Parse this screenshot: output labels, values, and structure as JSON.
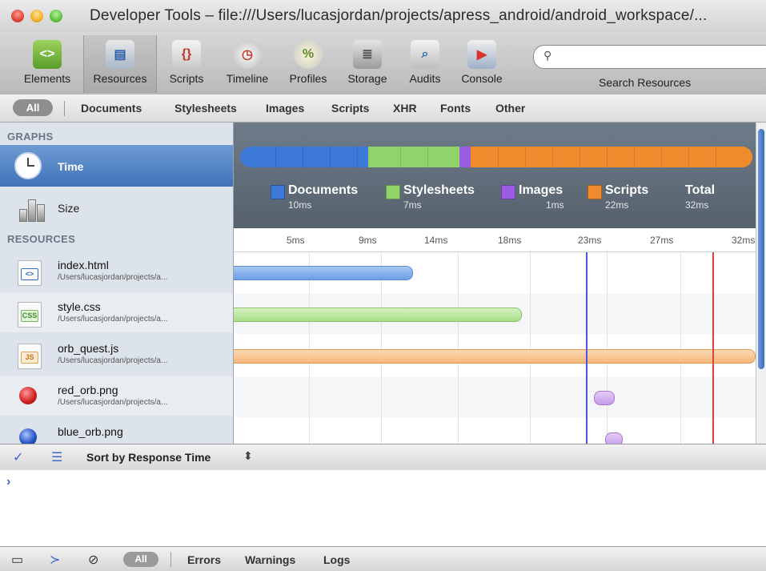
{
  "window": {
    "title": "Developer Tools – file:///Users/lucasjordan/projects/apress_android/android_workspace/..."
  },
  "toolbar": {
    "buttons": [
      {
        "label": "Elements",
        "icon": "elements-icon"
      },
      {
        "label": "Resources",
        "icon": "resources-icon"
      },
      {
        "label": "Scripts",
        "icon": "scripts-icon"
      },
      {
        "label": "Timeline",
        "icon": "timeline-icon"
      },
      {
        "label": "Profiles",
        "icon": "profiles-icon"
      },
      {
        "label": "Storage",
        "icon": "storage-icon"
      },
      {
        "label": "Audits",
        "icon": "audits-icon"
      },
      {
        "label": "Console",
        "icon": "console-icon"
      }
    ],
    "selected": "Resources",
    "search_label": "Search Resources",
    "search_placeholder": ""
  },
  "filter": {
    "all": "All",
    "items": [
      "Documents",
      "Stylesheets",
      "Images",
      "Scripts",
      "XHR",
      "Fonts",
      "Other"
    ]
  },
  "sidebar": {
    "graphs_header": "GRAPHS",
    "time_label": "Time",
    "size_label": "Size",
    "resources_header": "RESOURCES",
    "resources": [
      {
        "name": "index.html",
        "path": "/Users/lucasjordan/projects/a...",
        "type": "html"
      },
      {
        "name": "style.css",
        "path": "/Users/lucasjordan/projects/a...",
        "type": "css"
      },
      {
        "name": "orb_quest.js",
        "path": "/Users/lucasjordan/projects/a...",
        "type": "js"
      },
      {
        "name": "red_orb.png",
        "path": "/Users/lucasjordan/projects/a...",
        "type": "png-red"
      },
      {
        "name": "blue_orb.png",
        "path": "",
        "type": "png-blue"
      }
    ]
  },
  "graph": {
    "legend": [
      {
        "name": "Documents",
        "value": "10ms",
        "color": "#3b78d8"
      },
      {
        "name": "Stylesheets",
        "value": "7ms",
        "color": "#8fd36a"
      },
      {
        "name": "Images",
        "value": "1ms",
        "color": "#9a5ce0"
      },
      {
        "name": "Scripts",
        "value": "22ms",
        "color": "#f08b2d"
      },
      {
        "name": "Total",
        "value": "32ms",
        "color": ""
      }
    ],
    "ticks": [
      "5ms",
      "9ms",
      "14ms",
      "18ms",
      "23ms",
      "27ms",
      "32ms"
    ]
  },
  "status": {
    "sort_label": "Sort by Response Time",
    "sort_arrows": "⬍"
  },
  "console": {
    "prompt": "›"
  },
  "bottom": {
    "all": "All",
    "items": [
      "Errors",
      "Warnings",
      "Logs"
    ]
  },
  "colors": {
    "selection": "#3f72b8",
    "documents": "#3b78d8",
    "stylesheets": "#8fd36a",
    "images": "#9a5ce0",
    "scripts": "#f08b2d",
    "dom_content_line": "#4a56e0",
    "load_line": "#d94040"
  }
}
